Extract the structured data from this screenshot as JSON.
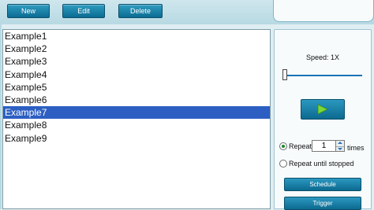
{
  "toolbar": {
    "new_label": "New",
    "edit_label": "Edit",
    "delete_label": "Delete"
  },
  "list": {
    "items": [
      {
        "label": "Example1",
        "selected": false
      },
      {
        "label": "Example2",
        "selected": false
      },
      {
        "label": "Example3",
        "selected": false
      },
      {
        "label": "Example4",
        "selected": false
      },
      {
        "label": "Example5",
        "selected": false
      },
      {
        "label": "Example6",
        "selected": false
      },
      {
        "label": "Example7",
        "selected": true
      },
      {
        "label": "Example8",
        "selected": false
      },
      {
        "label": "Example9",
        "selected": false
      }
    ]
  },
  "playback": {
    "speed_label": "Speed: 1X",
    "speed_slider_fraction": 0.0,
    "play_icon": "play-icon",
    "repeat_label": "Repeat",
    "repeat_value": "1",
    "repeat_suffix": "times",
    "repeat_selected": true,
    "repeat_until_stopped_label": "Repeat until stopped",
    "repeat_until_stopped_selected": false,
    "schedule_label": "Schedule",
    "trigger_label": "Trigger"
  },
  "colors": {
    "button_blue": "#0c6a90",
    "selection": "#2d5fc3",
    "play_green": "#7bd83a",
    "background": "#dfeef2"
  }
}
